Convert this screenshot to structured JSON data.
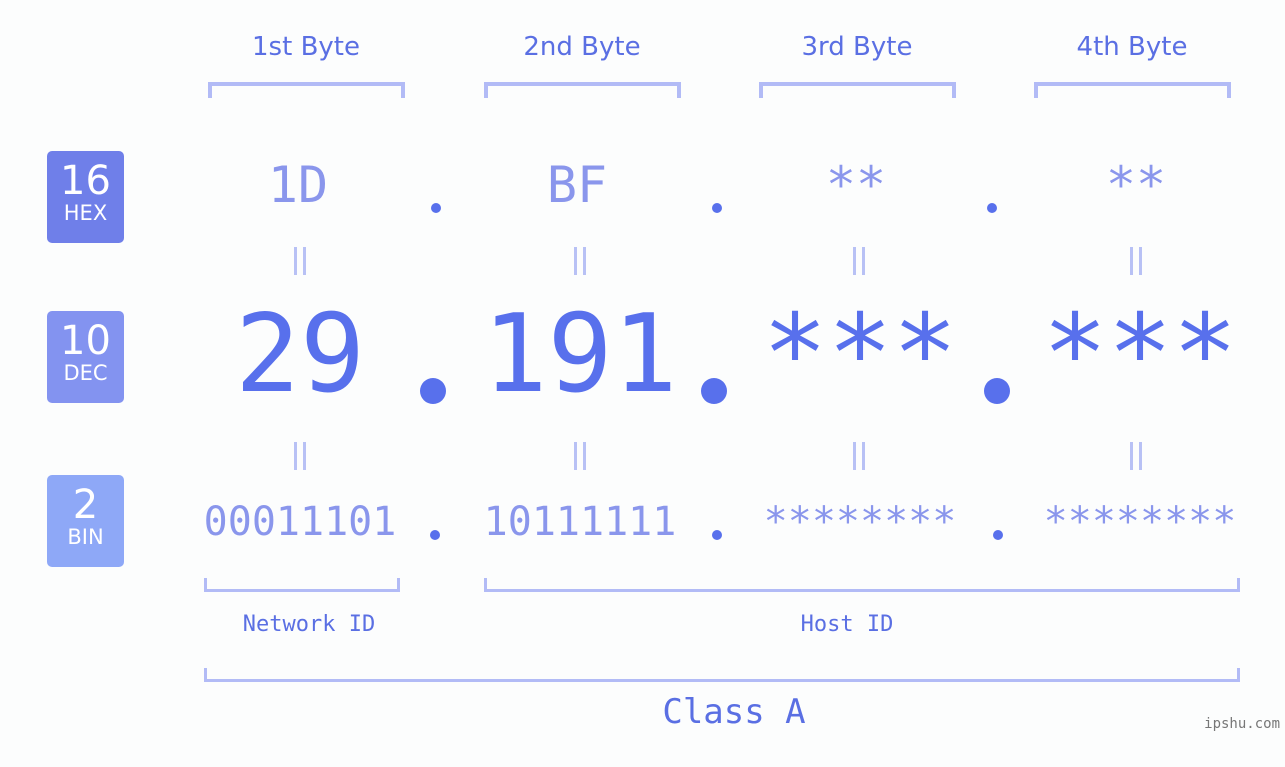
{
  "bytes": [
    {
      "header": "1st Byte",
      "hex": "1D",
      "dec": "29",
      "bin": "00011101"
    },
    {
      "header": "2nd Byte",
      "hex": "BF",
      "dec": "191",
      "bin": "10111111"
    },
    {
      "header": "3rd Byte",
      "hex": "**",
      "dec": "***",
      "bin": "********"
    },
    {
      "header": "4th Byte",
      "hex": "**",
      "dec": "***",
      "bin": "********"
    }
  ],
  "rows": {
    "hex": {
      "base": "16",
      "label": "HEX"
    },
    "dec": {
      "base": "10",
      "label": "DEC"
    },
    "bin": {
      "base": "2",
      "label": "BIN"
    }
  },
  "ids": {
    "network": "Network ID",
    "host": "Host ID"
  },
  "class_label": "Class A",
  "watermark": "ipshu.com",
  "colors": {
    "accent": "#5870ec",
    "light_text": "#8a96ec",
    "bracket": "#b2bbf6",
    "badge_hex": "#6f7fe9",
    "badge_dec": "#8393f0",
    "badge_bin": "#8ea8f7"
  }
}
